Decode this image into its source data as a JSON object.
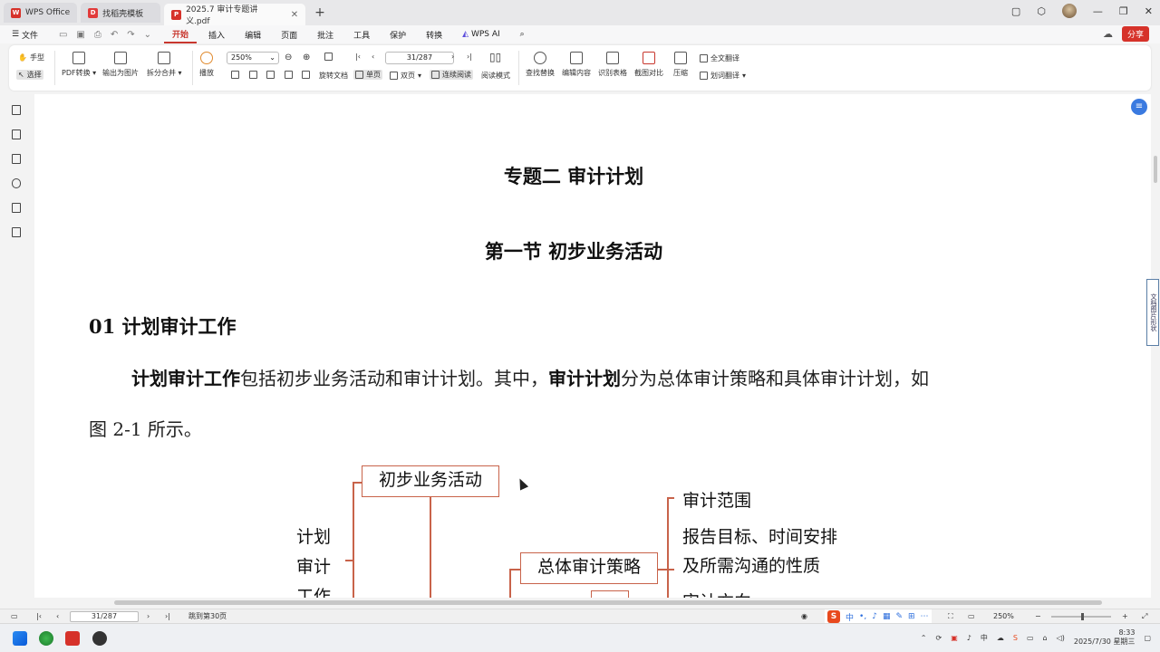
{
  "tabs": [
    {
      "label": "WPS Office",
      "active": false,
      "logo_color": "#d6322a",
      "logo": "W"
    },
    {
      "label": "找稻壳模板",
      "active": false,
      "logo_color": "#e23b3b",
      "logo": "D"
    },
    {
      "label": "2025.7  审计专题讲义.pdf",
      "active": true,
      "logo_color": "#d6322a",
      "logo": "P"
    }
  ],
  "menu": {
    "file": "文件",
    "items": [
      "开始",
      "插入",
      "编辑",
      "页面",
      "批注",
      "工具",
      "保护",
      "转换"
    ],
    "ai": "WPS AI",
    "share": "分享"
  },
  "ribbon": {
    "hand": "手型",
    "select": "选择",
    "pdf_convert": "PDF转换",
    "export_image": "输出为图片",
    "split_merge": "拆分合并",
    "play": "播放",
    "zoom": "250%",
    "page": "31/287",
    "rotate": "旋转文档",
    "single": "单页",
    "double": "双页",
    "continuous": "连续阅读",
    "read_mode": "阅读模式",
    "find_replace": "查找替换",
    "edit_content": "编辑内容",
    "recognize_table": "识别表格",
    "screenshot_compare": "截图对比",
    "compress": "压缩",
    "full_translate": "全文翻译",
    "word_translate": "划词翻译"
  },
  "document": {
    "topic_title": "专题二    审计计划",
    "section_title": "第一节    初步业务活动",
    "heading": "01 计划审计工作",
    "para_bold1": "计划审计工作",
    "para_text1": "包括初步业务活动和审计计划。其中，",
    "para_bold2": "审计计划",
    "para_text2": "分为总体审计策略和具体审计计划，如",
    "para_line2": "图 2-1 所示。",
    "diagram": {
      "box_prelim": "初步业务活动",
      "box_overall": "总体审计策略",
      "left_label_1": "计划",
      "left_label_2": "审计",
      "left_label_3": "工作",
      "right_1": "审计范围",
      "right_2a": "报告目标、时间安排",
      "right_2b": "及所需沟通的性质",
      "right_3": "审计方向"
    }
  },
  "side_panel": "文档图片形状",
  "status": {
    "page": "31/287",
    "goto": "跳到第30页",
    "zoom": "250%",
    "ime_logo": "S",
    "ime_mode": "中"
  },
  "clock": {
    "time": "8:33",
    "date": "2025/7/30 星期三"
  }
}
